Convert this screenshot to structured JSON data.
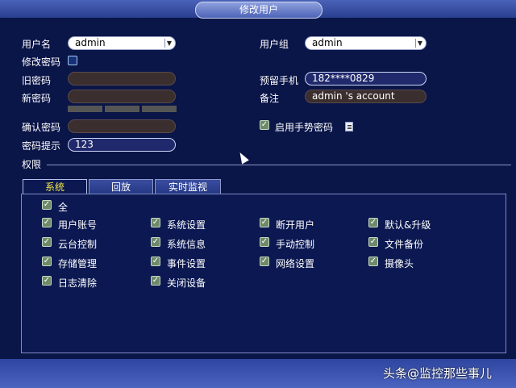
{
  "title": "修改用户",
  "form": {
    "username_label": "用户名",
    "username_value": "admin",
    "modify_password_label": "修改密码",
    "old_password_label": "旧密码",
    "new_password_label": "新密码",
    "confirm_password_label": "确认密码",
    "password_hint_label": "密码提示",
    "password_hint_value": "123",
    "user_group_label": "用户组",
    "user_group_value": "admin",
    "phone_label": "预留手机",
    "phone_value": "182****0829",
    "remark_label": "备注",
    "remark_value": "admin 's account",
    "gesture_password_label": "启用手势密码"
  },
  "permissions": {
    "section_label": "权限",
    "tabs": [
      "系统",
      "回放",
      "实时监视"
    ],
    "active_tab": "系统",
    "all_label": "全",
    "items": [
      "用户账号",
      "系统设置",
      "断开用户",
      "默认&升级",
      "云台控制",
      "系统信息",
      "手动控制",
      "文件备份",
      "存储管理",
      "事件设置",
      "网络设置",
      "摄像头",
      "日志清除",
      "关闭设备"
    ]
  },
  "watermark": "头条@监控那些事儿",
  "colors": {
    "background": "#0a1548",
    "active_tab_text": "#f3e64a",
    "check": "#6f8a6a"
  }
}
